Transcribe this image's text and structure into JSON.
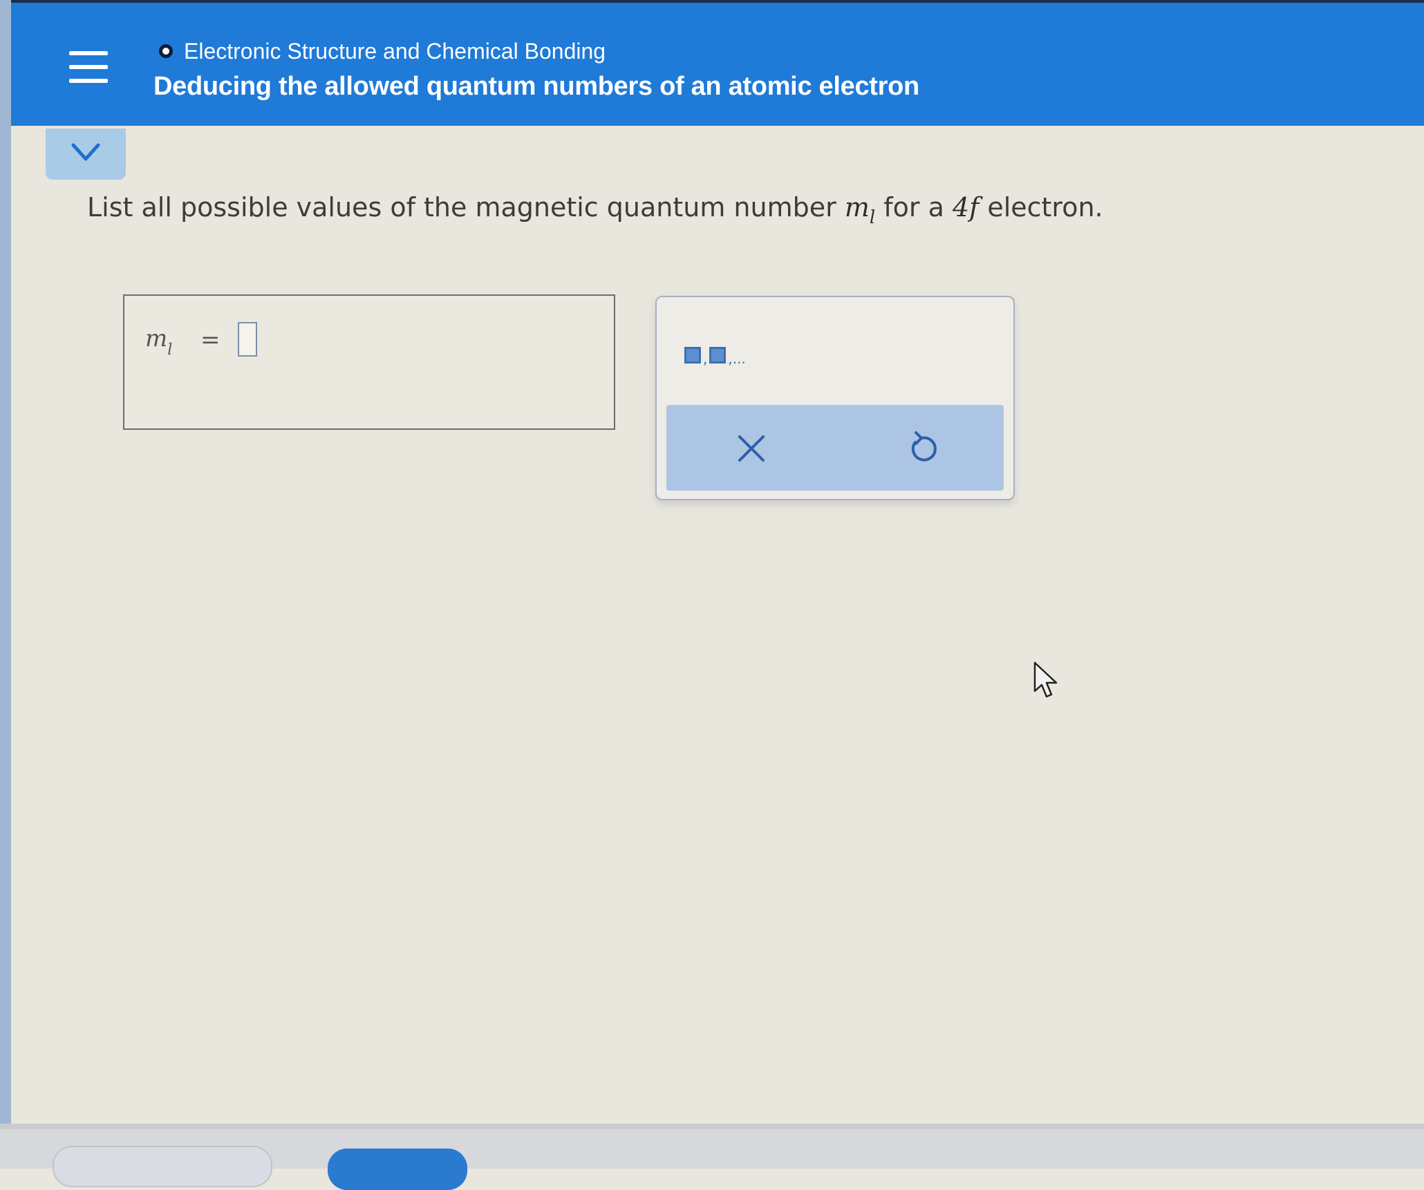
{
  "header": {
    "breadcrumb": "Electronic Structure and Chemical Bonding",
    "title": "Deducing the allowed quantum numbers of an atomic electron",
    "menu_icon": "hamburger-icon",
    "collapse_icon": "chevron-down-icon"
  },
  "question": {
    "prefix": "List all possible values of the magnetic quantum number ",
    "symbol": "m",
    "symbol_sub": "l",
    "middle": " for a ",
    "orbital": "4f",
    "suffix": " electron."
  },
  "answer": {
    "label": "m",
    "label_sub": "l",
    "equals": "=",
    "value": ""
  },
  "tools": {
    "list_template_icon": "list-template-icon",
    "list_separator": ",",
    "list_ellipsis": ",...",
    "clear_icon": "x-icon",
    "undo_icon": "undo-icon"
  },
  "colors": {
    "header_blue": "#1f7ad8",
    "tab_blue": "#a9cbe8",
    "action_bar": "#adc5e4",
    "background": "#e9e6dd"
  }
}
